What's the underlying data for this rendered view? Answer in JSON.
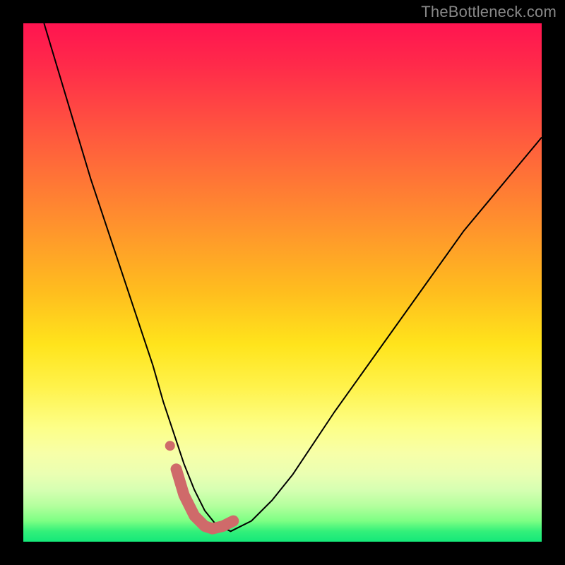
{
  "watermark": "TheBottleneck.com",
  "chart_data": {
    "type": "line",
    "title": "",
    "xlabel": "",
    "ylabel": "",
    "xlim": [
      0,
      100
    ],
    "ylim": [
      0,
      100
    ],
    "grid": false,
    "legend": false,
    "series": [
      {
        "name": "bottleneck-curve",
        "stroke": "#000000",
        "stroke_width": 2,
        "x": [
          4,
          7,
          10,
          13,
          16,
          19,
          22,
          25,
          27,
          29,
          31,
          33,
          35,
          37,
          40,
          44,
          48,
          52,
          56,
          60,
          65,
          70,
          75,
          80,
          85,
          90,
          95,
          100
        ],
        "y": [
          100,
          90,
          80,
          70,
          61,
          52,
          43,
          34,
          27,
          21,
          15,
          10,
          6,
          3.5,
          2,
          4,
          8,
          13,
          19,
          25,
          32,
          39,
          46,
          53,
          60,
          66,
          72,
          78
        ]
      },
      {
        "name": "highlight-band",
        "stroke": "#cf6a6a",
        "stroke_width": 16,
        "linecap": "round",
        "x": [
          29.5,
          31,
          33,
          35,
          36.5,
          38.5,
          40.5
        ],
        "y": [
          14,
          9,
          5,
          3,
          2.5,
          3,
          4
        ]
      }
    ],
    "markers": [
      {
        "name": "highlight-dot",
        "x": 28.3,
        "y": 18.5,
        "r": 7,
        "fill": "#cf6a6a"
      }
    ],
    "background_gradient": {
      "direction": "vertical",
      "stops": [
        {
          "pos": 0.0,
          "color": "#ff1450"
        },
        {
          "pos": 0.22,
          "color": "#ff5a3e"
        },
        {
          "pos": 0.52,
          "color": "#ffbe1e"
        },
        {
          "pos": 0.78,
          "color": "#fdff88"
        },
        {
          "pos": 0.93,
          "color": "#b5ff9e"
        },
        {
          "pos": 1.0,
          "color": "#15e879"
        }
      ]
    }
  }
}
